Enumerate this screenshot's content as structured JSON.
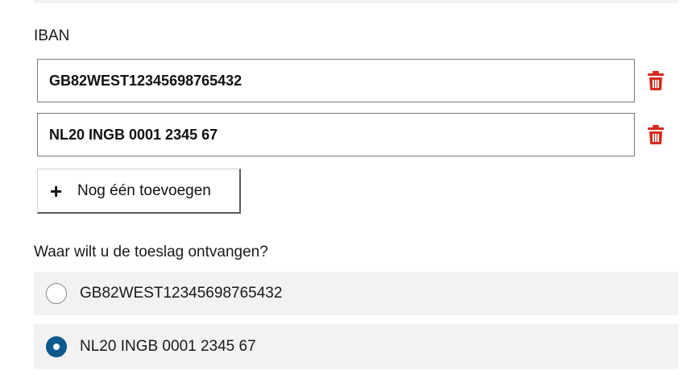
{
  "iban_section": {
    "label": "IBAN",
    "entries": [
      {
        "value": "GB82WEST12345698765432",
        "delete_icon": "trash-icon"
      },
      {
        "value": "NL20 INGB 0001 2345 67",
        "delete_icon": "trash-icon"
      }
    ],
    "add_button": {
      "icon": "plus-icon",
      "label": "Nog één toevoegen"
    }
  },
  "payout": {
    "question": "Waar wilt u de toeslag ontvangen?",
    "options": [
      {
        "label": "GB82WEST12345698765432",
        "selected": false
      },
      {
        "label": "NL20 INGB 0001 2345 67",
        "selected": true
      }
    ],
    "selected_color": "#0a5a8c"
  },
  "colors": {
    "delete": "#d52b1e",
    "option_background": "#f2f2f2"
  }
}
